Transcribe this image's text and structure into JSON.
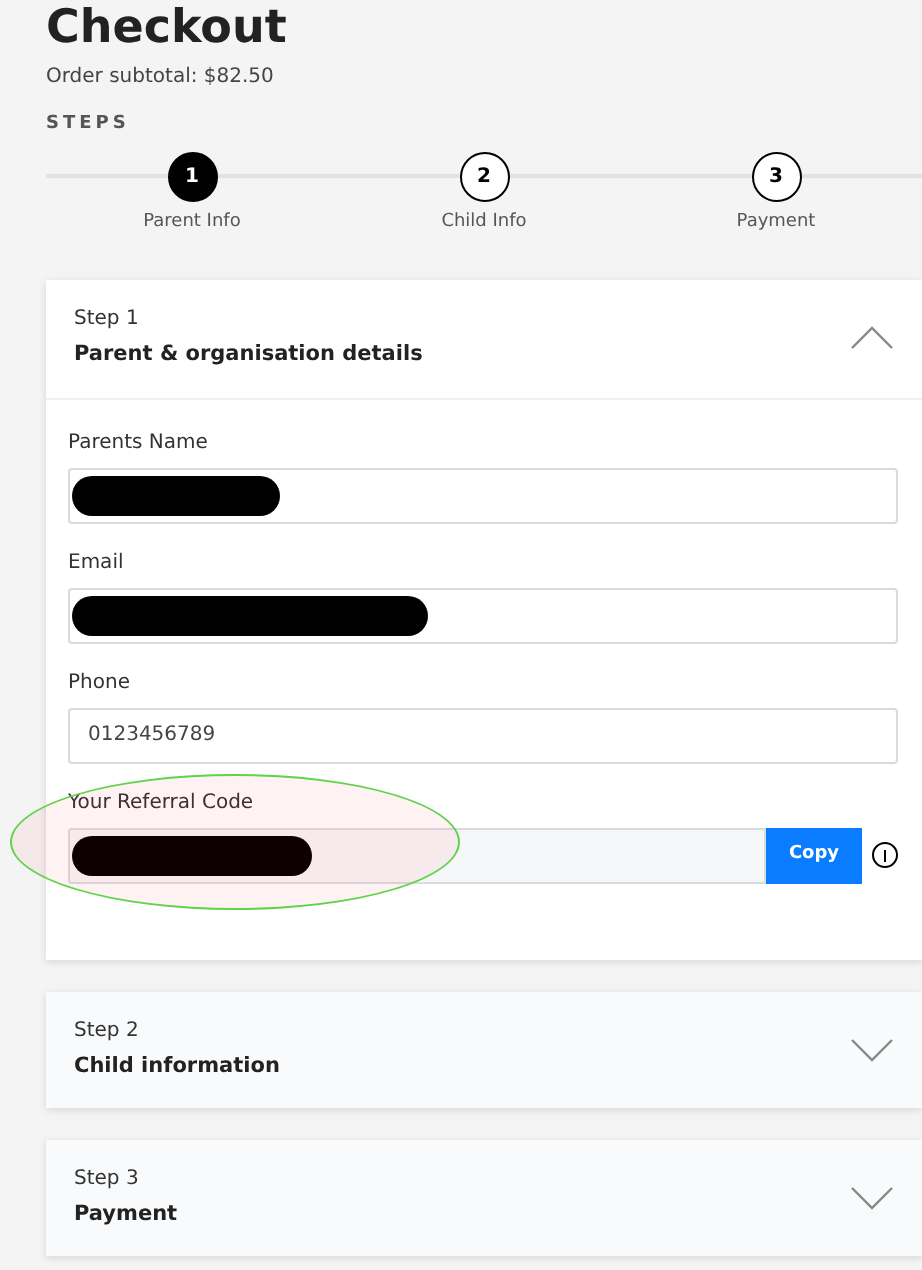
{
  "title": "Checkout",
  "subtotal": "Order subtotal: $82.50",
  "steps_label": "STEPS",
  "steps": [
    {
      "number": "1",
      "label": "Parent Info",
      "selected": true
    },
    {
      "number": "2",
      "label": "Child Info",
      "selected": false
    },
    {
      "number": "3",
      "label": "Payment",
      "selected": false
    }
  ],
  "sections": [
    {
      "step": "Step 1",
      "title": "Parent & organisation details",
      "expanded": true,
      "fields": [
        {
          "kind": "text",
          "label": "Parents Name",
          "redacted": true
        },
        {
          "kind": "text",
          "label": "Email",
          "redacted": true
        },
        {
          "kind": "text",
          "label": "Phone",
          "value": "0123456789",
          "redacted": false
        },
        {
          "kind": "copy",
          "label": "Your Referral Code",
          "redacted": true,
          "button": "Copy",
          "highlighted": true
        }
      ]
    },
    {
      "step": "Step 2",
      "title": "Child information",
      "expanded": false
    },
    {
      "step": "Step 3",
      "title": "Payment",
      "expanded": false
    }
  ]
}
